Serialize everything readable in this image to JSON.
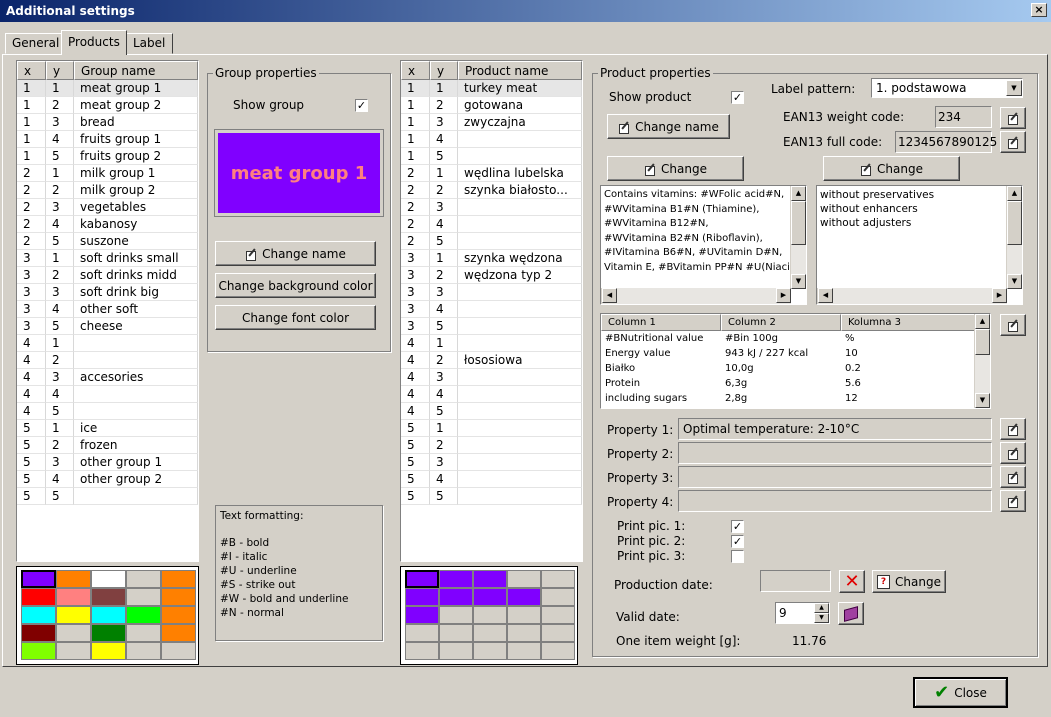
{
  "window": {
    "title": "Additional settings",
    "close": "×"
  },
  "tabs": [
    "General",
    "Products",
    "Label"
  ],
  "groups": {
    "headers": [
      "x",
      "y",
      "Group name"
    ],
    "rows": [
      [
        "1",
        "1",
        "meat group 1"
      ],
      [
        "1",
        "2",
        "meat group 2"
      ],
      [
        "1",
        "3",
        "bread"
      ],
      [
        "1",
        "4",
        "fruits group 1"
      ],
      [
        "1",
        "5",
        "fruits group 2"
      ],
      [
        "2",
        "1",
        "milk group 1"
      ],
      [
        "2",
        "2",
        "milk group 2"
      ],
      [
        "2",
        "3",
        "vegetables"
      ],
      [
        "2",
        "4",
        "kabanosy"
      ],
      [
        "2",
        "5",
        "suszone"
      ],
      [
        "3",
        "1",
        "soft drinks small"
      ],
      [
        "3",
        "2",
        "soft drinks midd"
      ],
      [
        "3",
        "3",
        "soft drink big"
      ],
      [
        "3",
        "4",
        "other soft"
      ],
      [
        "3",
        "5",
        "cheese"
      ],
      [
        "4",
        "1",
        ""
      ],
      [
        "4",
        "2",
        ""
      ],
      [
        "4",
        "3",
        "accesories"
      ],
      [
        "4",
        "4",
        ""
      ],
      [
        "4",
        "5",
        ""
      ],
      [
        "5",
        "1",
        "ice"
      ],
      [
        "5",
        "2",
        "frozen"
      ],
      [
        "5",
        "3",
        "other group 1"
      ],
      [
        "5",
        "4",
        "other group 2"
      ],
      [
        "5",
        "5",
        ""
      ]
    ]
  },
  "group_props": {
    "title": "Group properties",
    "show_group_label": "Show group",
    "show_group_checked": "✓",
    "preview_text": "meat group 1",
    "preview_bg": "#8000ff",
    "preview_fg": "#ff8080",
    "change_name": "Change name",
    "change_bg": "Change background color",
    "change_font": "Change font color"
  },
  "formatting": {
    "title": "Text formatting:",
    "lines": [
      "#B - bold",
      "#I - italic",
      "#U - underline",
      "#S - strike out",
      "#W - bold and underline",
      "#N - normal"
    ]
  },
  "products": {
    "headers": [
      "x",
      "y",
      "Product name"
    ],
    "rows": [
      [
        "1",
        "1",
        "turkey meat"
      ],
      [
        "1",
        "2",
        "gotowana"
      ],
      [
        "1",
        "3",
        "zwyczajna"
      ],
      [
        "1",
        "4",
        ""
      ],
      [
        "1",
        "5",
        ""
      ],
      [
        "2",
        "1",
        "wędlina lubelska"
      ],
      [
        "2",
        "2",
        "szynka białosto..."
      ],
      [
        "2",
        "3",
        ""
      ],
      [
        "2",
        "4",
        ""
      ],
      [
        "2",
        "5",
        ""
      ],
      [
        "3",
        "1",
        "szynka wędzona"
      ],
      [
        "3",
        "2",
        "wędzona typ 2"
      ],
      [
        "3",
        "3",
        ""
      ],
      [
        "3",
        "4",
        ""
      ],
      [
        "3",
        "5",
        ""
      ],
      [
        "4",
        "1",
        ""
      ],
      [
        "4",
        "2",
        "łososiowa"
      ],
      [
        "4",
        "3",
        ""
      ],
      [
        "4",
        "4",
        ""
      ],
      [
        "4",
        "5",
        ""
      ],
      [
        "5",
        "1",
        ""
      ],
      [
        "5",
        "2",
        ""
      ],
      [
        "5",
        "3",
        ""
      ],
      [
        "5",
        "4",
        ""
      ],
      [
        "5",
        "5",
        ""
      ]
    ]
  },
  "product_props": {
    "title": "Product properties",
    "show_product_label": "Show product",
    "show_product_checked": "✓",
    "label_pattern_label": "Label pattern:",
    "label_pattern_value": "1. podstawowa",
    "change_name": "Change name",
    "ean_weight_label": "EAN13 weight code:",
    "ean_weight_value": "234",
    "ean_full_label": "EAN13 full code:",
    "ean_full_value": "1234567890125",
    "change1": "Change",
    "change2": "Change",
    "vitamins_text": [
      "Contains vitamins: #WFolic acid#N,",
      "#WVitamina B1#N (Thiamine),",
      "#WVitamina B12#N,",
      "#WVitamina B2#N (Riboflavin),",
      "#IVitamina B6#N, #UVitamin D#N,",
      "Vitamin E, #BVitamin PP#N #U(Niacin)"
    ],
    "additives_text": [
      "without preservatives",
      "without enhancers",
      "without adjusters"
    ],
    "nutrition": {
      "headers": [
        "Column 1",
        "Column 2",
        "Kolumna 3"
      ],
      "rows": [
        [
          "#BNutritional value",
          "#Bin 100g",
          "%"
        ],
        [
          "Energy value",
          "943 kJ / 227 kcal",
          "10"
        ],
        [
          "Białko",
          "10,0g",
          "0.2"
        ],
        [
          "Protein",
          "6,3g",
          "5.6"
        ],
        [
          "including sugars",
          "2,8g",
          "12"
        ]
      ]
    },
    "properties": [
      {
        "label": "Property 1:",
        "value": "Optimal temperature: 2-10°C"
      },
      {
        "label": "Property 2:",
        "value": ""
      },
      {
        "label": "Property 3:",
        "value": ""
      },
      {
        "label": "Property 4:",
        "value": ""
      }
    ],
    "print_pics": [
      {
        "label": "Print pic. 1:",
        "checked": "✓"
      },
      {
        "label": "Print pic. 2:",
        "checked": "✓"
      },
      {
        "label": "Print pic. 3:",
        "checked": ""
      }
    ],
    "production_date_label": "Production date:",
    "production_date_value": "",
    "change3": "Change",
    "valid_date_label": "Valid date:",
    "valid_date_value": "9",
    "weight_label": "One item weight [g]:",
    "weight_value": "11.76"
  },
  "close_button": "Close",
  "palette_colors": {
    "group": [
      [
        "#8000ff",
        "#ff8000",
        "#ffffff",
        "#d4d0c8",
        "#ff8000"
      ],
      [
        "#ff0000",
        "#ff8080",
        "#804040",
        "#d4d0c8",
        "#ff8000"
      ],
      [
        "#00ffff",
        "#ffff00",
        "#00ffff",
        "#00ff00",
        "#ff8000"
      ],
      [
        "#800000",
        "#d4d0c8",
        "#008000",
        "#d4d0c8",
        "#ff8000"
      ],
      [
        "#80ff00",
        "#d4d0c8",
        "#ffff00",
        "#d4d0c8",
        "#d4d0c8"
      ]
    ],
    "product": [
      [
        "#8000ff",
        "#8000ff",
        "#8000ff",
        "#d4d0c8",
        "#d4d0c8"
      ],
      [
        "#8000ff",
        "#8000ff",
        "#8000ff",
        "#8000ff",
        "#d4d0c8"
      ],
      [
        "#8000ff",
        "#d4d0c8",
        "#d4d0c8",
        "#d4d0c8",
        "#d4d0c8"
      ],
      [
        "#d4d0c8",
        "#d4d0c8",
        "#d4d0c8",
        "#d4d0c8",
        "#d4d0c8"
      ],
      [
        "#d4d0c8",
        "#d4d0c8",
        "#d4d0c8",
        "#d4d0c8",
        "#d4d0c8"
      ]
    ]
  }
}
